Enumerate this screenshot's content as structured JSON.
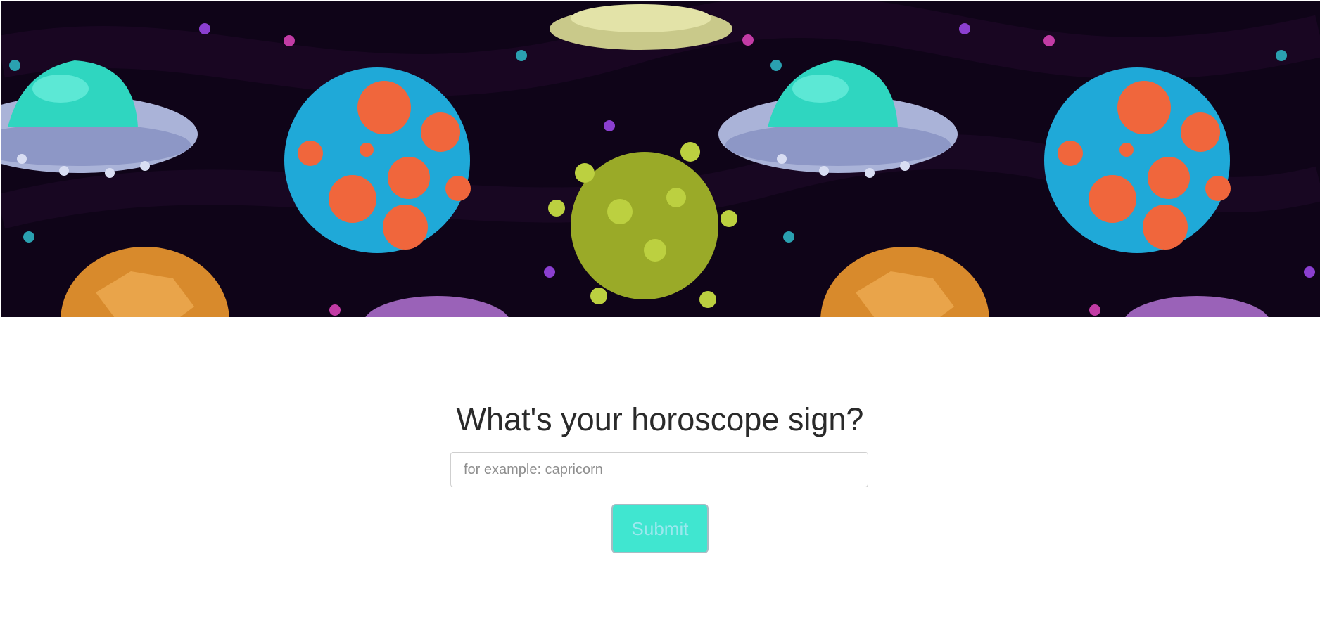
{
  "banner": {
    "alt": "space-themed banner with UFOs and planets",
    "colors": {
      "background": "#0f0418",
      "ufo_dome": "#2fd6c0",
      "ufo_body": "#aab3d8",
      "blue_planet": "#1fa9d8",
      "crater": "#f0663c",
      "virus_planet": "#9aaa28",
      "rock_planet": "#d88a2c"
    }
  },
  "main": {
    "heading": "What's your horoscope sign?",
    "input": {
      "value": "",
      "placeholder": "for example: capricorn"
    },
    "submit_label": "Submit",
    "colors": {
      "submit_bg": "#40e6d0",
      "heading_text": "#2a2a2a"
    }
  }
}
